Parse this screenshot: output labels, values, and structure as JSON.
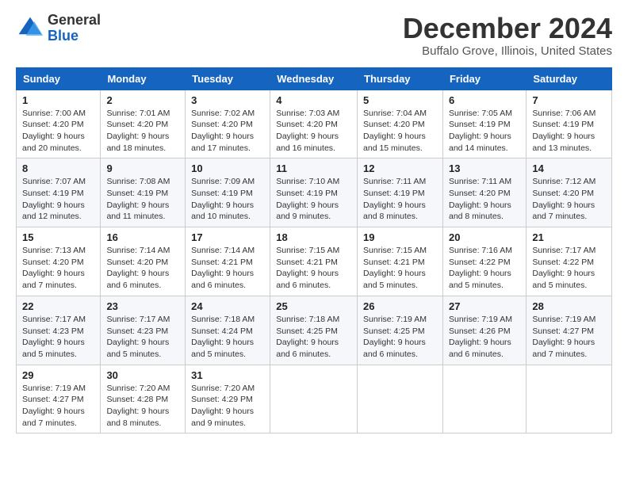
{
  "logo": {
    "general": "General",
    "blue": "Blue"
  },
  "title": "December 2024",
  "location": "Buffalo Grove, Illinois, United States",
  "days_of_week": [
    "Sunday",
    "Monday",
    "Tuesday",
    "Wednesday",
    "Thursday",
    "Friday",
    "Saturday"
  ],
  "weeks": [
    [
      {
        "day": "1",
        "sunrise": "Sunrise: 7:00 AM",
        "sunset": "Sunset: 4:20 PM",
        "daylight": "Daylight: 9 hours and 20 minutes."
      },
      {
        "day": "2",
        "sunrise": "Sunrise: 7:01 AM",
        "sunset": "Sunset: 4:20 PM",
        "daylight": "Daylight: 9 hours and 18 minutes."
      },
      {
        "day": "3",
        "sunrise": "Sunrise: 7:02 AM",
        "sunset": "Sunset: 4:20 PM",
        "daylight": "Daylight: 9 hours and 17 minutes."
      },
      {
        "day": "4",
        "sunrise": "Sunrise: 7:03 AM",
        "sunset": "Sunset: 4:20 PM",
        "daylight": "Daylight: 9 hours and 16 minutes."
      },
      {
        "day": "5",
        "sunrise": "Sunrise: 7:04 AM",
        "sunset": "Sunset: 4:20 PM",
        "daylight": "Daylight: 9 hours and 15 minutes."
      },
      {
        "day": "6",
        "sunrise": "Sunrise: 7:05 AM",
        "sunset": "Sunset: 4:19 PM",
        "daylight": "Daylight: 9 hours and 14 minutes."
      },
      {
        "day": "7",
        "sunrise": "Sunrise: 7:06 AM",
        "sunset": "Sunset: 4:19 PM",
        "daylight": "Daylight: 9 hours and 13 minutes."
      }
    ],
    [
      {
        "day": "8",
        "sunrise": "Sunrise: 7:07 AM",
        "sunset": "Sunset: 4:19 PM",
        "daylight": "Daylight: 9 hours and 12 minutes."
      },
      {
        "day": "9",
        "sunrise": "Sunrise: 7:08 AM",
        "sunset": "Sunset: 4:19 PM",
        "daylight": "Daylight: 9 hours and 11 minutes."
      },
      {
        "day": "10",
        "sunrise": "Sunrise: 7:09 AM",
        "sunset": "Sunset: 4:19 PM",
        "daylight": "Daylight: 9 hours and 10 minutes."
      },
      {
        "day": "11",
        "sunrise": "Sunrise: 7:10 AM",
        "sunset": "Sunset: 4:19 PM",
        "daylight": "Daylight: 9 hours and 9 minutes."
      },
      {
        "day": "12",
        "sunrise": "Sunrise: 7:11 AM",
        "sunset": "Sunset: 4:19 PM",
        "daylight": "Daylight: 9 hours and 8 minutes."
      },
      {
        "day": "13",
        "sunrise": "Sunrise: 7:11 AM",
        "sunset": "Sunset: 4:20 PM",
        "daylight": "Daylight: 9 hours and 8 minutes."
      },
      {
        "day": "14",
        "sunrise": "Sunrise: 7:12 AM",
        "sunset": "Sunset: 4:20 PM",
        "daylight": "Daylight: 9 hours and 7 minutes."
      }
    ],
    [
      {
        "day": "15",
        "sunrise": "Sunrise: 7:13 AM",
        "sunset": "Sunset: 4:20 PM",
        "daylight": "Daylight: 9 hours and 7 minutes."
      },
      {
        "day": "16",
        "sunrise": "Sunrise: 7:14 AM",
        "sunset": "Sunset: 4:20 PM",
        "daylight": "Daylight: 9 hours and 6 minutes."
      },
      {
        "day": "17",
        "sunrise": "Sunrise: 7:14 AM",
        "sunset": "Sunset: 4:21 PM",
        "daylight": "Daylight: 9 hours and 6 minutes."
      },
      {
        "day": "18",
        "sunrise": "Sunrise: 7:15 AM",
        "sunset": "Sunset: 4:21 PM",
        "daylight": "Daylight: 9 hours and 6 minutes."
      },
      {
        "day": "19",
        "sunrise": "Sunrise: 7:15 AM",
        "sunset": "Sunset: 4:21 PM",
        "daylight": "Daylight: 9 hours and 5 minutes."
      },
      {
        "day": "20",
        "sunrise": "Sunrise: 7:16 AM",
        "sunset": "Sunset: 4:22 PM",
        "daylight": "Daylight: 9 hours and 5 minutes."
      },
      {
        "day": "21",
        "sunrise": "Sunrise: 7:17 AM",
        "sunset": "Sunset: 4:22 PM",
        "daylight": "Daylight: 9 hours and 5 minutes."
      }
    ],
    [
      {
        "day": "22",
        "sunrise": "Sunrise: 7:17 AM",
        "sunset": "Sunset: 4:23 PM",
        "daylight": "Daylight: 9 hours and 5 minutes."
      },
      {
        "day": "23",
        "sunrise": "Sunrise: 7:17 AM",
        "sunset": "Sunset: 4:23 PM",
        "daylight": "Daylight: 9 hours and 5 minutes."
      },
      {
        "day": "24",
        "sunrise": "Sunrise: 7:18 AM",
        "sunset": "Sunset: 4:24 PM",
        "daylight": "Daylight: 9 hours and 5 minutes."
      },
      {
        "day": "25",
        "sunrise": "Sunrise: 7:18 AM",
        "sunset": "Sunset: 4:25 PM",
        "daylight": "Daylight: 9 hours and 6 minutes."
      },
      {
        "day": "26",
        "sunrise": "Sunrise: 7:19 AM",
        "sunset": "Sunset: 4:25 PM",
        "daylight": "Daylight: 9 hours and 6 minutes."
      },
      {
        "day": "27",
        "sunrise": "Sunrise: 7:19 AM",
        "sunset": "Sunset: 4:26 PM",
        "daylight": "Daylight: 9 hours and 6 minutes."
      },
      {
        "day": "28",
        "sunrise": "Sunrise: 7:19 AM",
        "sunset": "Sunset: 4:27 PM",
        "daylight": "Daylight: 9 hours and 7 minutes."
      }
    ],
    [
      {
        "day": "29",
        "sunrise": "Sunrise: 7:19 AM",
        "sunset": "Sunset: 4:27 PM",
        "daylight": "Daylight: 9 hours and 7 minutes."
      },
      {
        "day": "30",
        "sunrise": "Sunrise: 7:20 AM",
        "sunset": "Sunset: 4:28 PM",
        "daylight": "Daylight: 9 hours and 8 minutes."
      },
      {
        "day": "31",
        "sunrise": "Sunrise: 7:20 AM",
        "sunset": "Sunset: 4:29 PM",
        "daylight": "Daylight: 9 hours and 9 minutes."
      },
      null,
      null,
      null,
      null
    ]
  ]
}
